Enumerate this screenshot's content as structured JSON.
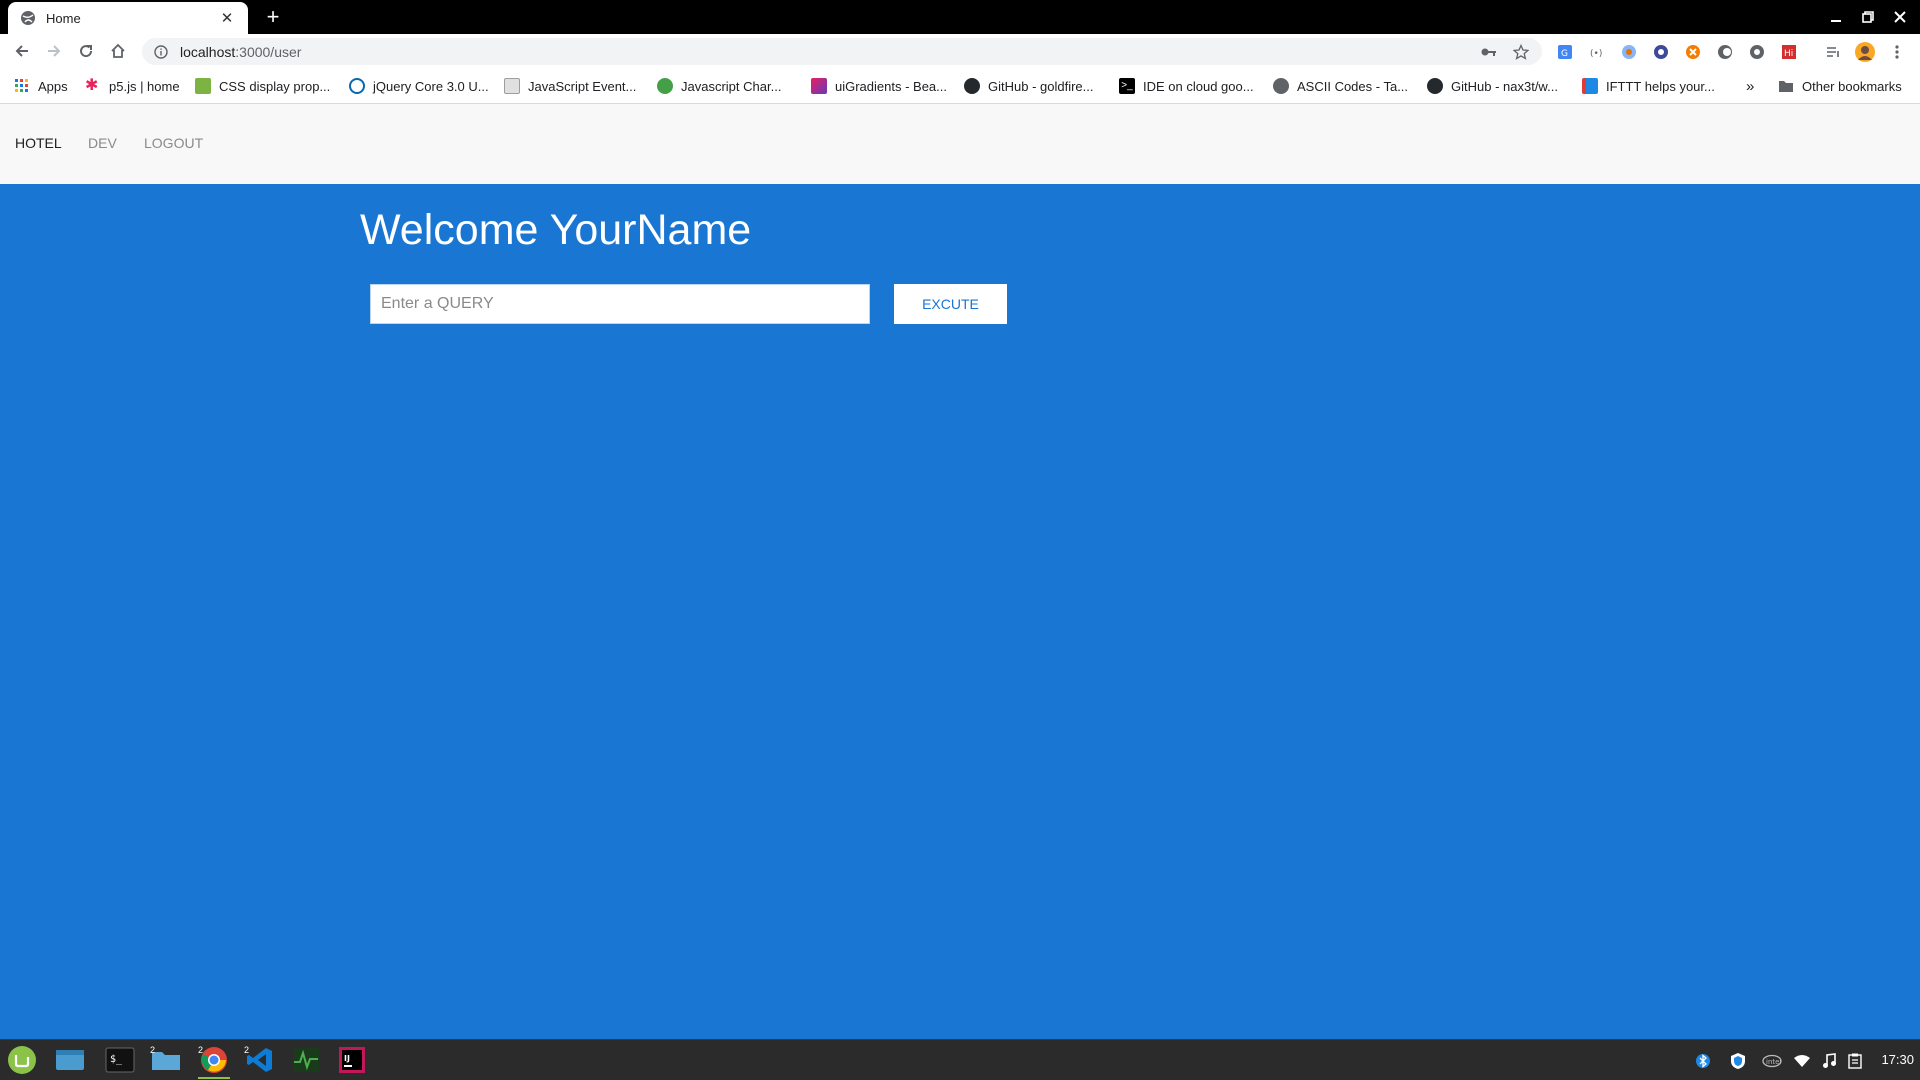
{
  "browser": {
    "tab": {
      "title": "Home",
      "favicon": "globe-icon"
    },
    "url": {
      "host": "localhost",
      "path": ":3000/user"
    },
    "bookmarks": [
      {
        "label": "Apps",
        "icon": "apps-grid-icon"
      },
      {
        "label": "p5.js | home",
        "icon": "p5-star-icon"
      },
      {
        "label": "CSS display prop...",
        "icon": "css-icon"
      },
      {
        "label": "jQuery Core 3.0 U...",
        "icon": "jquery-icon"
      },
      {
        "label": "JavaScript Event...",
        "icon": "page-icon"
      },
      {
        "label": "Javascript Char...",
        "icon": "chart-icon"
      },
      {
        "label": "uiGradients - Bea...",
        "icon": "gradient-icon"
      },
      {
        "label": "GitHub - goldfire...",
        "icon": "github-icon"
      },
      {
        "label": "IDE on cloud goo...",
        "icon": "terminal-icon"
      },
      {
        "label": "ASCII Codes - Ta...",
        "icon": "globe-icon"
      },
      {
        "label": "GitHub - nax3t/w...",
        "icon": "github-icon"
      },
      {
        "label": "IFTTT helps your...",
        "icon": "ifttt-icon"
      }
    ],
    "overflow": "»",
    "other_bookmarks": "Other bookmarks"
  },
  "appnav": {
    "items": [
      {
        "label": "HOTEL",
        "active": true
      },
      {
        "label": "DEV",
        "active": false
      },
      {
        "label": "LOGOUT",
        "active": false
      }
    ]
  },
  "main": {
    "welcome": "Welcome YourName",
    "query_placeholder": "Enter a QUERY",
    "query_value": "",
    "execute_label": "EXCUTE"
  },
  "taskbar": {
    "apps": [
      {
        "name": "mint-menu-icon"
      },
      {
        "name": "files-icon"
      },
      {
        "name": "terminal-icon"
      },
      {
        "name": "folder-icon",
        "badge": "2"
      },
      {
        "name": "chrome-icon",
        "badge": "2"
      },
      {
        "name": "vscode-icon",
        "badge": "2"
      },
      {
        "name": "system-monitor-icon"
      },
      {
        "name": "intellij-icon"
      }
    ],
    "clock": "17:30"
  },
  "colors": {
    "primary": "#1976d2",
    "navbar": "#f8f8f8",
    "taskbar": "#2b2b2b"
  }
}
